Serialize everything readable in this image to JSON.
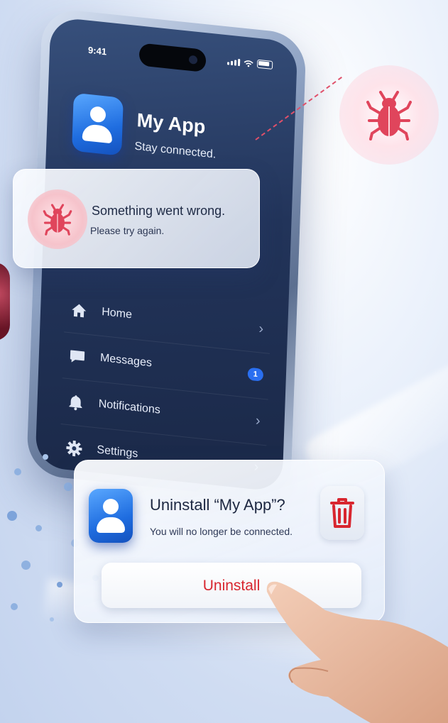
{
  "status_bar": {
    "time": "9:41"
  },
  "app": {
    "name": "My App",
    "tagline": "Stay connected.",
    "icon": "person-icon",
    "accent_color": "#1f6de0"
  },
  "error_toast": {
    "icon": "bug-icon",
    "title": "Something went wrong.",
    "message": "Please try again.",
    "color": "#e0455c"
  },
  "menu": {
    "items": [
      {
        "label": "Home",
        "icon": "home-icon"
      },
      {
        "label": "Messages",
        "icon": "chat-bubble-icon",
        "badge": "1"
      },
      {
        "label": "Notifications",
        "icon": "bell-icon"
      },
      {
        "label": "Settings",
        "icon": "gear-icon"
      }
    ]
  },
  "uninstall_dialog": {
    "title": "Uninstall “My App”?",
    "message": "You will no longer be connected.",
    "button_label": "Uninstall",
    "icon": "trash-icon",
    "danger_color": "#d8262f"
  }
}
